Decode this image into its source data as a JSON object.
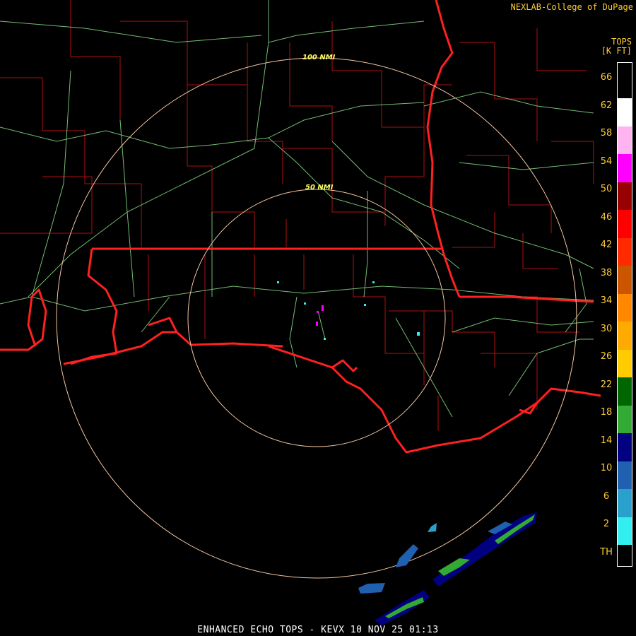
{
  "credit": "NEXLAB-College of DuPage",
  "legend": {
    "title": "TOPS",
    "units": "[K FT]",
    "labels": [
      "66",
      "62",
      "58",
      "54",
      "50",
      "46",
      "42",
      "38",
      "34",
      "30",
      "26",
      "22",
      "18",
      "14",
      "10",
      "6",
      "2",
      "TH"
    ],
    "colors": [
      "#ffffff",
      "#ffb3f0",
      "#ff00ff",
      "#990000",
      "#ff0000",
      "#ff2a00",
      "#cc5500",
      "#ff8800",
      "#ffaa00",
      "#ffcc00",
      "#006600",
      "#33aa33",
      "#000080",
      "#2060b0",
      "#2aa0cc",
      "#33eeee"
    ]
  },
  "range_rings": [
    {
      "label": "50 NMI"
    },
    {
      "label": "100 NMI"
    }
  ],
  "caption": "ENHANCED ECHO TOPS - KEVX 10 NOV 25 01:13",
  "colors": {
    "background": "#000000",
    "county_lines": "#b01010",
    "state_lines": "#ff2020",
    "highways": "#88dd88",
    "rings": "#f5c6a0",
    "text": "#ffcc33"
  }
}
